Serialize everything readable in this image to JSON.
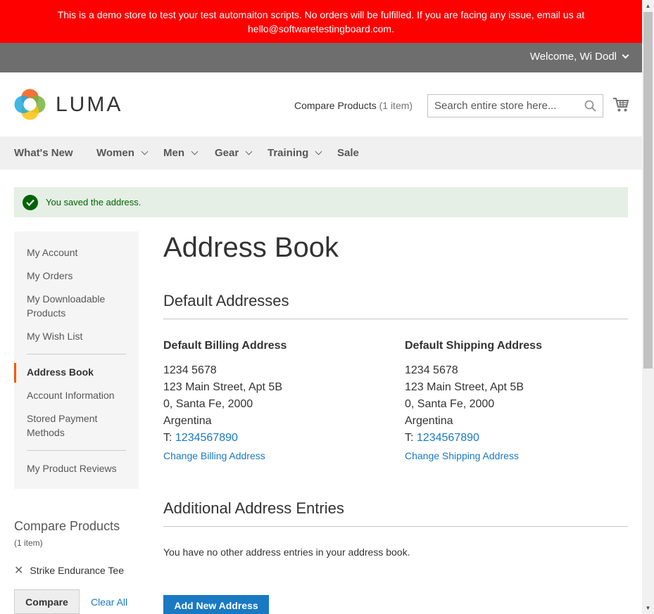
{
  "banner": {
    "line1": "This is a demo store to test your test automaiton scripts. No orders will be fulfilled. If you are facing any issue, email us at",
    "line2": "hello@softwaretestingboard.com."
  },
  "header": {
    "welcome": "Welcome, Wi Dodl",
    "logo_text": "LUMA",
    "compare_label": "Compare Products",
    "compare_count": "(1 item)",
    "search_placeholder": "Search entire store here..."
  },
  "nav": {
    "items": [
      {
        "label": "What's New",
        "dropdown": false
      },
      {
        "label": "Women",
        "dropdown": true
      },
      {
        "label": "Men",
        "dropdown": true
      },
      {
        "label": "Gear",
        "dropdown": true
      },
      {
        "label": "Training",
        "dropdown": true
      },
      {
        "label": "Sale",
        "dropdown": false
      }
    ]
  },
  "message": {
    "text": "You saved the address."
  },
  "sidebar": {
    "items": [
      {
        "label": "My Account"
      },
      {
        "label": "My Orders"
      },
      {
        "label": "My Downloadable Products"
      },
      {
        "label": "My Wish List"
      },
      {
        "label": "Address Book",
        "active": true
      },
      {
        "label": "Account Information"
      },
      {
        "label": "Stored Payment Methods"
      },
      {
        "label": "My Product Reviews"
      }
    ]
  },
  "compare_block": {
    "title": "Compare Products",
    "count": "(1 item)",
    "product": "Strike Endurance Tee",
    "compare_button": "Compare",
    "clear_all": "Clear All"
  },
  "main": {
    "title": "Address Book",
    "default_section": "Default Addresses",
    "billing": {
      "heading": "Default Billing Address",
      "line1": "1234 5678",
      "line2": "123 Main Street, Apt 5B",
      "line3": "0, Santa Fe, 2000",
      "line4": "Argentina",
      "phone_prefix": "T:",
      "phone": "1234567890",
      "change_link": "Change Billing Address"
    },
    "shipping": {
      "heading": "Default Shipping Address",
      "line1": "1234 5678",
      "line2": "123 Main Street, Apt 5B",
      "line3": "0, Santa Fe, 2000",
      "line4": "Argentina",
      "phone_prefix": "T:",
      "phone": "1234567890",
      "change_link": "Change Shipping Address"
    },
    "additional_section": "Additional Address Entries",
    "empty_note": "You have no other address entries in your address book.",
    "add_button": "Add New Address"
  },
  "colors": {
    "banner": "#ff0000",
    "header_bar": "#6e6e6e",
    "link": "#1979c3",
    "active_marker": "#ff5501",
    "success": "#006400"
  }
}
